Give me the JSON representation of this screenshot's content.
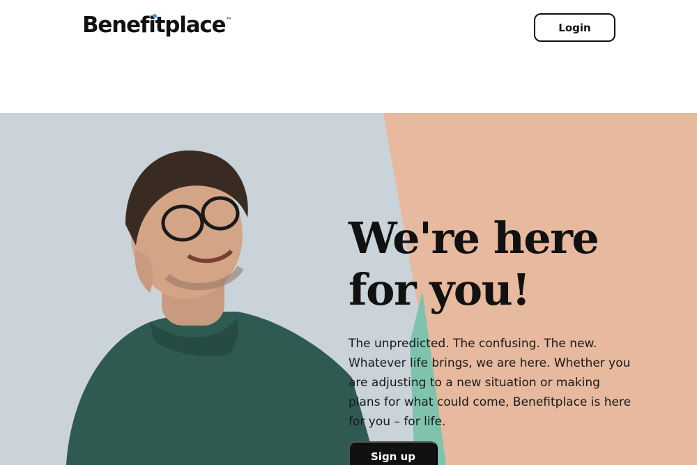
{
  "header": {
    "logo_text": "Benefitplace",
    "logo_tm": "™",
    "login_label": "Login"
  },
  "hero": {
    "headline": "We're here for you!",
    "body": "The unpredicted. The confusing. The new. Whatever life brings, we are here. Whether you are adjusting to a new situation or making plans for what could come, Benefitplace is here for you – for life.",
    "signup_label": "Sign up"
  },
  "colors": {
    "accent_dot": "#3d9be0",
    "photo_background": "#c9d3d9",
    "peach_panel": "#e7b99e",
    "teal_accent": "#7fc3ae",
    "sweater": "#2f5a52"
  }
}
